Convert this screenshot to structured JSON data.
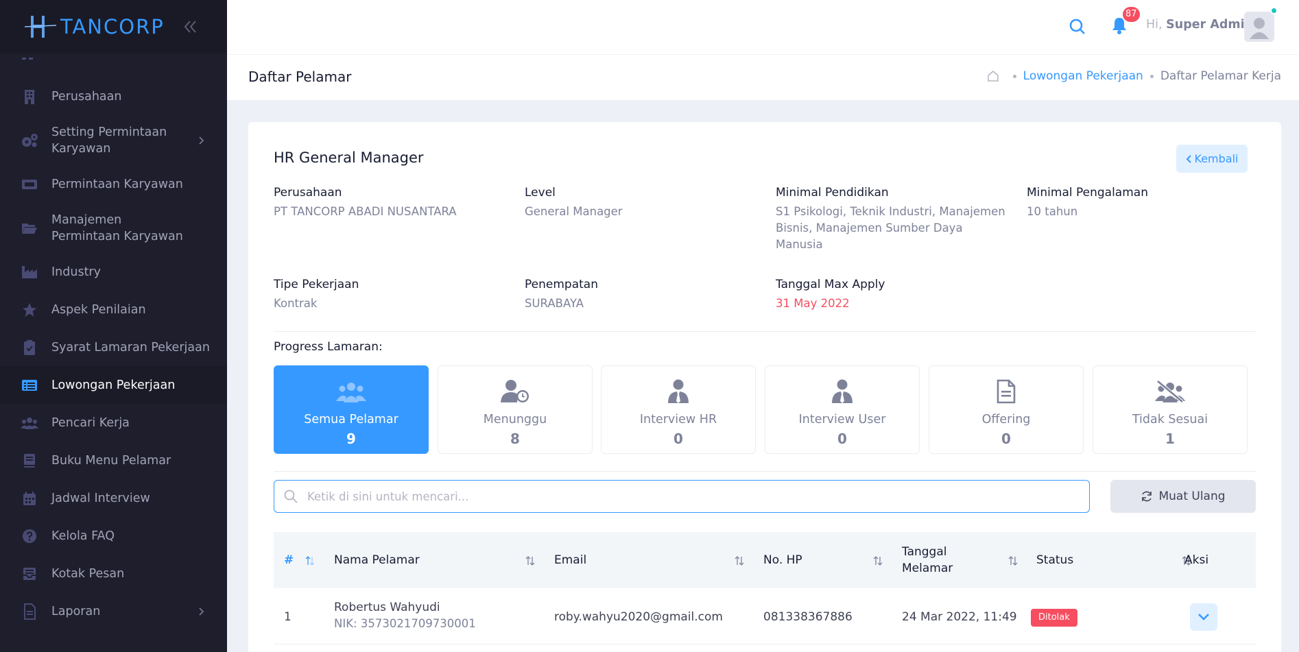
{
  "brand": {
    "name": "TANCORP"
  },
  "sidebar": {
    "items": [
      {
        "label": "Perusahaan",
        "icon": "building-icon"
      },
      {
        "label": "Setting Permintaan Karyawan",
        "icon": "gears-icon",
        "has_children": true
      },
      {
        "label": "Permintaan Karyawan",
        "icon": "ticket-icon"
      },
      {
        "label": "Manajemen Permintaan Karyawan",
        "icon": "folder-open-icon"
      },
      {
        "label": "Industry",
        "icon": "industry-icon"
      },
      {
        "label": "Aspek Penilaian",
        "icon": "star-icon"
      },
      {
        "label": "Syarat Lamaran Pekerjaan",
        "icon": "clipboard-check-icon"
      },
      {
        "label": "Lowongan Pekerjaan",
        "icon": "list-alt-icon",
        "active": true
      },
      {
        "label": "Pencari Kerja",
        "icon": "users-icon"
      },
      {
        "label": "Buku Menu Pelamar",
        "icon": "book-icon"
      },
      {
        "label": "Jadwal Interview",
        "icon": "calendar-icon"
      },
      {
        "label": "Kelola FAQ",
        "icon": "question-circle-icon"
      },
      {
        "label": "Kotak Pesan",
        "icon": "inbox-icon"
      },
      {
        "label": "Laporan",
        "icon": "file-icon",
        "has_children": true
      }
    ]
  },
  "header": {
    "notif_count": "87",
    "greeting": "Hi,",
    "user_name": "Super Admin"
  },
  "subheader": {
    "title": "Daftar Pelamar",
    "breadcrumb": [
      "Lowongan Pekerjaan",
      "Daftar Pelamar Kerja"
    ]
  },
  "job": {
    "title": "HR General Manager",
    "back_label": "Kembali",
    "fields": {
      "perusahaan": {
        "label": "Perusahaan",
        "value": "PT TANCORP ABADI NUSANTARA"
      },
      "level": {
        "label": "Level",
        "value": "General Manager"
      },
      "pendidikan": {
        "label": "Minimal Pendidikan",
        "value": "S1 Psikologi, Teknik Industri, Manajemen Bisnis, Manajemen Sumber Daya Manusia"
      },
      "pengalaman": {
        "label": "Minimal Pengalaman",
        "value": "10 tahun"
      },
      "tipe": {
        "label": "Tipe Pekerjaan",
        "value": "Kontrak"
      },
      "penempatan": {
        "label": "Penempatan",
        "value": "SURABAYA"
      },
      "tanggal_max": {
        "label": "Tanggal Max Apply",
        "value": "31 May 2022"
      }
    }
  },
  "progress": {
    "label": "Progress Lamaran:",
    "stages": [
      {
        "label": "Semua Pelamar",
        "count": "9",
        "icon": "users-icon",
        "active": true
      },
      {
        "label": "Menunggu",
        "count": "8",
        "icon": "user-clock-icon"
      },
      {
        "label": "Interview HR",
        "count": "0",
        "icon": "user-tie-icon"
      },
      {
        "label": "Interview User",
        "count": "0",
        "icon": "user-tie-icon"
      },
      {
        "label": "Offering",
        "count": "0",
        "icon": "file-alt-icon"
      },
      {
        "label": "Tidak Sesuai",
        "count": "1",
        "icon": "users-slash-icon"
      }
    ]
  },
  "search": {
    "placeholder": "Ketik di sini untuk mencari...",
    "value": ""
  },
  "reload_label": "Muat Ulang",
  "table": {
    "columns": [
      "#",
      "Nama Pelamar",
      "Email",
      "No. HP",
      "Tanggal Melamar",
      "Status",
      "Aksi"
    ],
    "rows": [
      {
        "no": "1",
        "name": "Robertus Wahyudi",
        "nik": "NIK: 3573021709730001",
        "email": "roby.wahyu2020@gmail.com",
        "phone": "081338367886",
        "date": "24 Mar 2022, 11:49",
        "status": "Ditolak"
      }
    ]
  },
  "colors": {
    "primary": "#3699ff",
    "danger": "#f64e60",
    "sidebar": "#1e1e2d"
  }
}
